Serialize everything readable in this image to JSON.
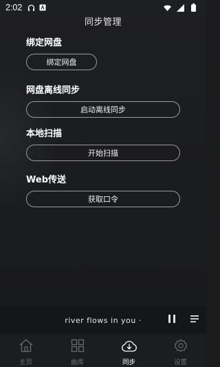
{
  "status": {
    "time": "2:02"
  },
  "page": {
    "title": "同步管理"
  },
  "sections": [
    {
      "title": "绑定网盘",
      "button": "绑定网盘"
    },
    {
      "title": "网盘离线同步",
      "button": "启动离线同步"
    },
    {
      "title": "本地扫描",
      "button": "开始扫描"
    },
    {
      "title": "Web传送",
      "button": "获取口令"
    }
  ],
  "player": {
    "song": "river  flows  in  you ·",
    "icons": [
      "pause-icon",
      "playlist-icon"
    ]
  },
  "tabs": [
    {
      "label": "主页",
      "icon": "home-icon",
      "active": false
    },
    {
      "label": "曲库",
      "icon": "library-grid-icon",
      "active": false
    },
    {
      "label": "同步",
      "icon": "sync-cloud-icon",
      "active": true
    },
    {
      "label": "设置",
      "icon": "settings-gear-icon",
      "active": false
    }
  ],
  "colors": {
    "background": "#1a1b1d",
    "button_border": "#9a9b9e",
    "inactive_tab": "#6a6b6e"
  }
}
